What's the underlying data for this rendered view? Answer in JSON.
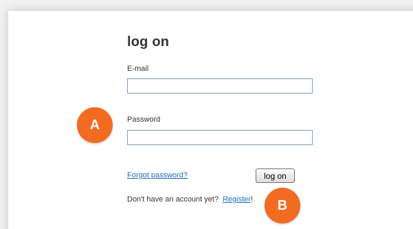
{
  "form": {
    "title": "log on",
    "email_label": "E-mail",
    "email_value": "",
    "password_label": "Password",
    "password_value": "",
    "forgot_link": "Forgot password?",
    "logon_button": "log on",
    "signup_prompt": "Don't have an account yet?",
    "register_link": "Register",
    "register_suffix": "!"
  },
  "annotations": {
    "a": "A",
    "b": "B"
  },
  "colors": {
    "marker": "#f26b21",
    "link": "#1d6fb8",
    "field_border": "#7f9db9"
  }
}
